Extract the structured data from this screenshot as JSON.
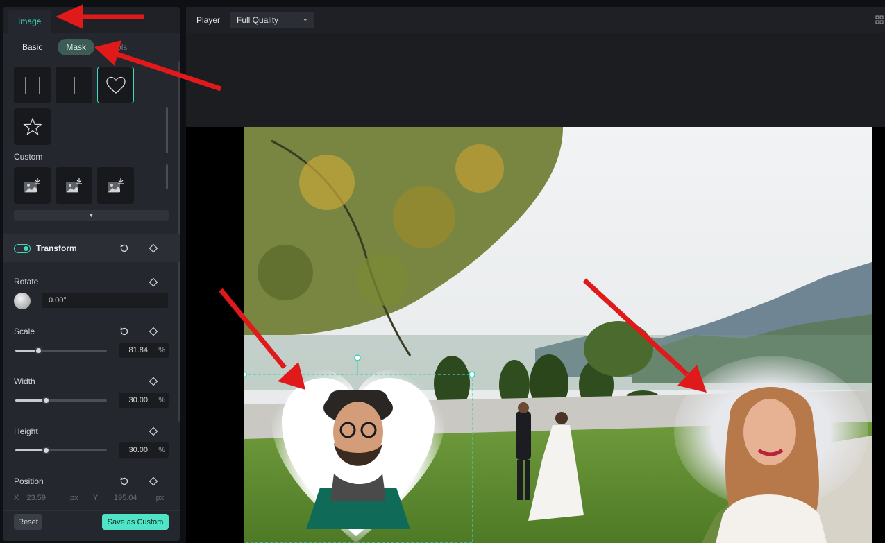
{
  "left_panel": {
    "top_tabs": [
      {
        "label": "Image",
        "active": true
      },
      {
        "label": "",
        "active": false
      }
    ],
    "sub_tabs": [
      {
        "label": "Basic",
        "active": false
      },
      {
        "label": "Mask",
        "active": true
      },
      {
        "label": "ols",
        "active": false
      }
    ],
    "shapes": [
      "double-line-icon",
      "single-line-icon",
      "heart-icon",
      "star-icon"
    ],
    "selected_shape": "heart-icon",
    "custom_label": "Custom",
    "custom_items": [
      "image-import-icon",
      "image-import-icon",
      "image-import-icon"
    ],
    "expand_icon": "chevron-down-icon",
    "transform": {
      "label": "Transform",
      "enabled": true
    },
    "rotate": {
      "label": "Rotate",
      "value": "0.00°"
    },
    "scale": {
      "label": "Scale",
      "value": "81.84",
      "unit": "%",
      "level": 0.25
    },
    "width": {
      "label": "Width",
      "value": "30.00",
      "unit": "%",
      "level": 0.33
    },
    "height": {
      "label": "Height",
      "value": "30.00",
      "unit": "%",
      "level": 0.33
    },
    "position": {
      "label": "Position",
      "x_label": "X",
      "x_value": "23.59",
      "x_unit": "px",
      "y_label": "Y",
      "y_value": "195.04",
      "y_unit": "px"
    },
    "reset_label": "Reset",
    "save_label": "Save as Custom"
  },
  "player": {
    "label": "Player",
    "quality": "Full Quality"
  },
  "colors": {
    "accent": "#4fe3c7",
    "annotation_arrow": "#e0191b",
    "panel_bg": "#24272d"
  }
}
